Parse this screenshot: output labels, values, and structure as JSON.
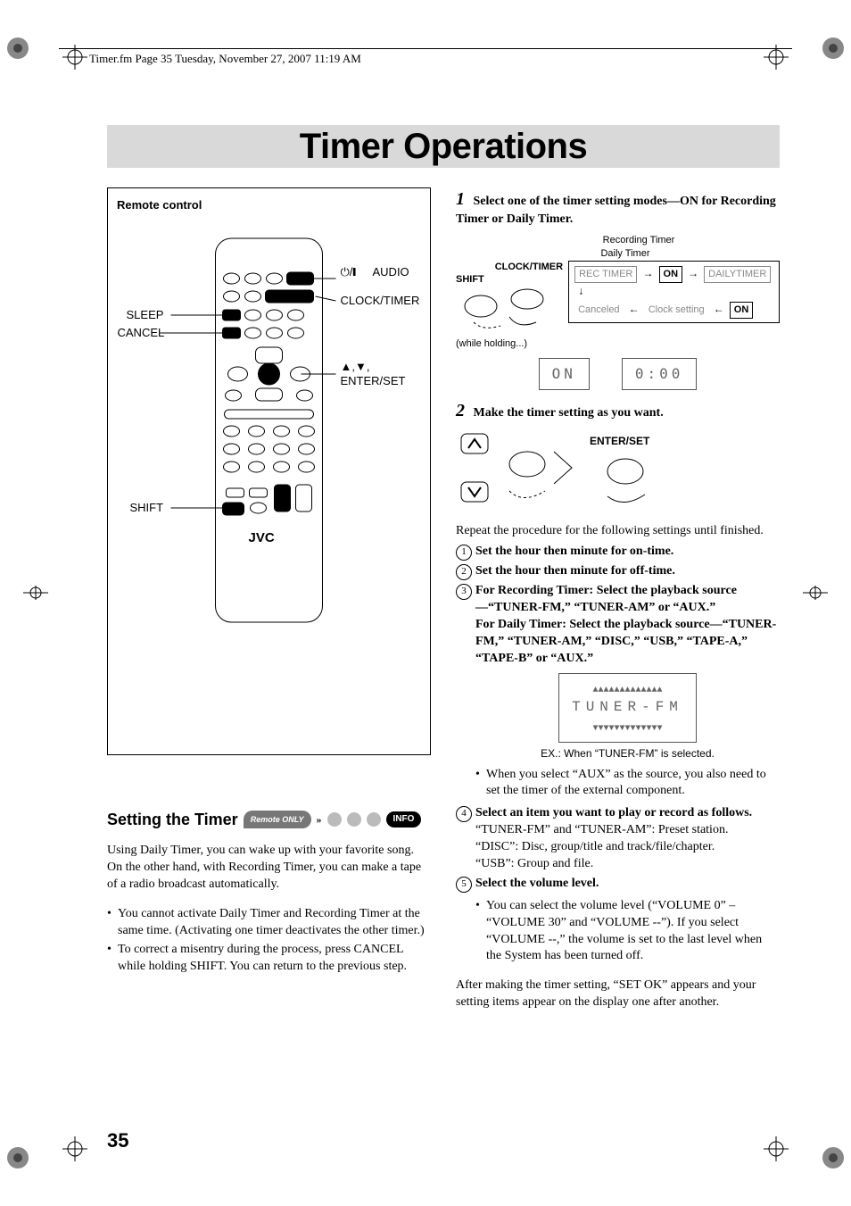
{
  "header_line": "Timer.fm  Page 35  Tuesday, November 27, 2007  11:19 AM",
  "title": "Timer Operations",
  "remote": {
    "caption": "Remote control",
    "labels": {
      "audio": "AUDIO",
      "audio_icon": "⏻/❙",
      "clock_timer": "CLOCK/TIMER",
      "sleep": "SLEEP",
      "cancel": "CANCEL",
      "enter_set": "ENTER/SET",
      "nav_icon": "▲,▼,",
      "shift": "SHIFT",
      "brand": "JVC"
    }
  },
  "section": {
    "title": "Setting the Timer",
    "badge_remote": "Remote ONLY",
    "badge_info": "INFO"
  },
  "intro": "Using Daily Timer, you can wake up with your favorite song. On the other hand, with Recording Timer, you can make a tape of a radio broadcast automatically.",
  "intro_bullets": [
    "You cannot activate Daily Timer and Recording Timer at the same time. (Activating one timer deactivates the other timer.)",
    "To correct a misentry during the process, press CANCEL while holding SHIFT. You can return to the previous step."
  ],
  "steps": {
    "s1": {
      "num": "1",
      "lead": "Select one of the timer setting modes—ON for Recording Timer or Daily Timer.",
      "labels": {
        "rec_timer_title": "Recording Timer",
        "daily_timer_title": "Daily Timer",
        "clock_timer": "CLOCK/TIMER",
        "shift": "SHIFT",
        "while_holding": "(while holding...)",
        "rec_timer": "REC TIMER",
        "on": "ON",
        "daily_timer": "DAILYTIMER",
        "canceled": "Canceled",
        "clock_setting": "Clock setting",
        "lcd_on": "ON",
        "lcd_time": "0:00"
      }
    },
    "s2": {
      "num": "2",
      "lead": "Make the timer setting as you want.",
      "enter_set": "ENTER/SET",
      "repeat": "Repeat the procedure for the following settings until finished.",
      "items": {
        "i1": "Set the hour then minute for on-time.",
        "i2": "Set the hour then minute for off-time.",
        "i3a": "For Recording Timer: Select the playback source—“TUNER-FM,” “TUNER-AM” or “AUX.”",
        "i3b": "For Daily Timer: Select the playback source—“TUNER-FM,” “TUNER-AM,” “DISC,” “USB,” “TAPE-A,” “TAPE-B” or “AUX.”",
        "i4": "Select an item you want to play or record as follows.",
        "i5": "Select the volume level."
      },
      "lcd_example": "TUNER-FM",
      "ex_caption": "EX.: When “TUNER-FM” is selected.",
      "aux_note": "When you select “AUX” as the source, you also need to set the timer of the external component.",
      "i4_lines": [
        "“TUNER-FM” and “TUNER-AM”: Preset station.",
        "“DISC”: Disc, group/title and track/file/chapter.",
        "“USB”: Group and file."
      ],
      "i5_note": "You can select the volume level (“VOLUME 0” – “VOLUME 30” and “VOLUME --”). If you select “VOLUME --,” the volume is set to the last level when the System has been turned off."
    }
  },
  "after": "After making the timer setting, “SET OK” appears and your setting items appear on the display one after another.",
  "page_number": "35"
}
